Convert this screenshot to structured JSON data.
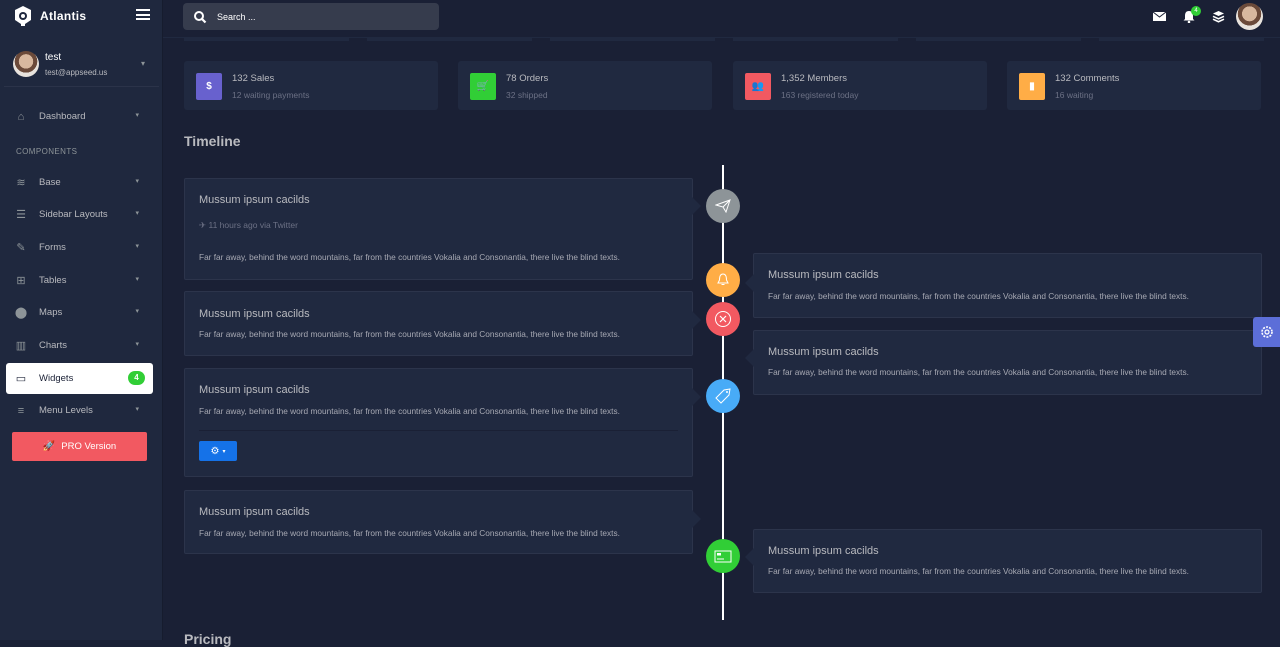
{
  "app": {
    "title": "Atlantis"
  },
  "user": {
    "name": "test",
    "email": "test@appseed.us"
  },
  "sidebar": {
    "section_label": "COMPONENTS",
    "items": [
      {
        "label": "Dashboard",
        "icon": "home-icon"
      },
      {
        "label": "Base",
        "icon": "layers-icon"
      },
      {
        "label": "Sidebar Layouts",
        "icon": "th-list-icon"
      },
      {
        "label": "Forms",
        "icon": "pen-square-icon"
      },
      {
        "label": "Tables",
        "icon": "table-icon"
      },
      {
        "label": "Maps",
        "icon": "map-marker-icon"
      },
      {
        "label": "Charts",
        "icon": "chart-bar-icon"
      },
      {
        "label": "Widgets",
        "icon": "desktop-icon",
        "badge": "4",
        "active": true
      },
      {
        "label": "Menu Levels",
        "icon": "bars-icon"
      }
    ],
    "pro_button": "PRO Version"
  },
  "topbar": {
    "search_placeholder": "Search ...",
    "notification_count": "4"
  },
  "stats": [
    {
      "title": "132 Sales",
      "sub": "12 waiting payments",
      "icon": "dollar-icon",
      "color": "#6861ce"
    },
    {
      "title": "78 Orders",
      "sub": "32 shipped",
      "icon": "cart-icon",
      "color": "#31ce36"
    },
    {
      "title": "1,352 Members",
      "sub": "163 registered today",
      "icon": "users-icon",
      "color": "#f25961"
    },
    {
      "title": "132 Comments",
      "sub": "16 waiting",
      "icon": "comment-icon",
      "color": "#ffad46"
    }
  ],
  "timeline": {
    "heading": "Timeline",
    "items": [
      {
        "title": "Mussum ipsum cacilds",
        "meta": "11 hours ago via Twitter",
        "text": "Far far away, behind the word mountains, far from the countries Vokalia and Consonantia, there live the blind texts."
      },
      {
        "title": "Mussum ipsum cacilds",
        "text": "Far far away, behind the word mountains, far from the countries Vokalia and Consonantia, there live the blind texts."
      },
      {
        "title": "Mussum ipsum cacilds",
        "text": "Far far away, behind the word mountains, far from the countries Vokalia and Consonantia, there live the blind texts."
      },
      {
        "title": "Mussum ipsum cacilds",
        "text": "Far far away, behind the word mountains, far from the countries Vokalia and Consonantia, there live the blind texts."
      },
      {
        "title": "Mussum ipsum cacilds",
        "text": "Far far away, behind the word mountains, far from the countries Vokalia and Consonantia, there live the blind texts."
      },
      {
        "title": "Mussum ipsum cacilds",
        "text": "Far far away, behind the word mountains, far from the countries Vokalia and Consonantia, there live the blind texts."
      },
      {
        "title": "Mussum ipsum cacilds",
        "text": "Far far away, behind the word mountains, far from the countries Vokalia and Consonantia, there live the blind texts."
      }
    ],
    "badges": [
      {
        "icon": "paper-plane-icon",
        "color": "#8d9498"
      },
      {
        "icon": "bell-icon",
        "color": "#ffad46"
      },
      {
        "icon": "close-circle-icon",
        "color": "#f25961"
      },
      {
        "icon": "tag-icon",
        "color": "#48abf7"
      },
      {
        "icon": "credit-card-icon",
        "color": "#31ce36"
      }
    ]
  },
  "next_section": "Pricing"
}
